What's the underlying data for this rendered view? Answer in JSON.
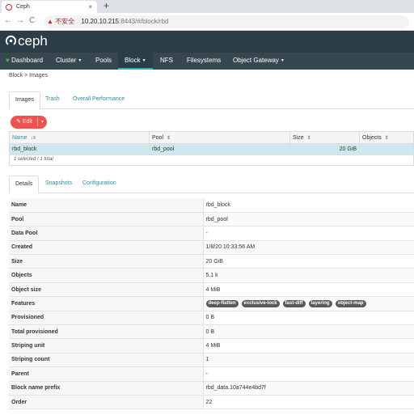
{
  "browser": {
    "tab_title": "Ceph",
    "tab_close": "×",
    "new_tab": "+",
    "back": "←",
    "forward": "→",
    "reload": "C",
    "warning_icon": "▲",
    "insecure_label": "不安全",
    "url_host": "10.20.10.215",
    "url_rest": ":8443/#/block/rbd"
  },
  "app": {
    "brand": "ceph",
    "nav": [
      "Dashboard",
      "Cluster",
      "Pools",
      "Block",
      "NFS",
      "Filesystems",
      "Object Gateway"
    ],
    "active_nav": "Block",
    "accent": "#2ab3bd",
    "header_bg": "#2b3e48"
  },
  "breadcrumb": {
    "parent": "Block",
    "separator": ">",
    "current": "Images"
  },
  "top_tabs": [
    "Images",
    "Trash",
    "Overall Performance"
  ],
  "toolbar": {
    "edit_label": "Edit",
    "edit_color": "#ef5350"
  },
  "images_table": {
    "columns": [
      "Name",
      "Pool",
      "Size",
      "Objects"
    ],
    "rows": [
      {
        "name": "rbd_block",
        "pool": "rbd_pool",
        "size": "20 GiB",
        "objects": ""
      }
    ],
    "footer": "1 selected / 1 total"
  },
  "detail_tabs": [
    "Details",
    "Snapshots",
    "Configuration"
  ],
  "details": {
    "name_label": "Name",
    "name": "rbd_block",
    "pool_label": "Pool",
    "pool": "rbd_pool",
    "data_pool_label": "Data Pool",
    "data_pool": "-",
    "created_label": "Created",
    "created": "1/8/20 10:33:56 AM",
    "size_label": "Size",
    "size": "20 GiB",
    "objects_label": "Objects",
    "objects": "5.1 k",
    "object_size_label": "Object size",
    "object_size": "4 MiB",
    "features_label": "Features",
    "features": [
      "deep-flatten",
      "exclusive-lock",
      "fast-diff",
      "layering",
      "object-map"
    ],
    "provisioned_label": "Provisioned",
    "provisioned": "0 B",
    "total_provisioned_label": "Total provisioned",
    "total_provisioned": "0 B",
    "striping_unit_label": "Striping unit",
    "striping_unit": "4 MiB",
    "striping_count_label": "Striping count",
    "striping_count": "1",
    "parent_label": "Parent",
    "parent": "-",
    "block_name_prefix_label": "Block name prefix",
    "block_name_prefix": "rbd_data.10a744e4bd7f",
    "order_label": "Order",
    "order": "22"
  }
}
